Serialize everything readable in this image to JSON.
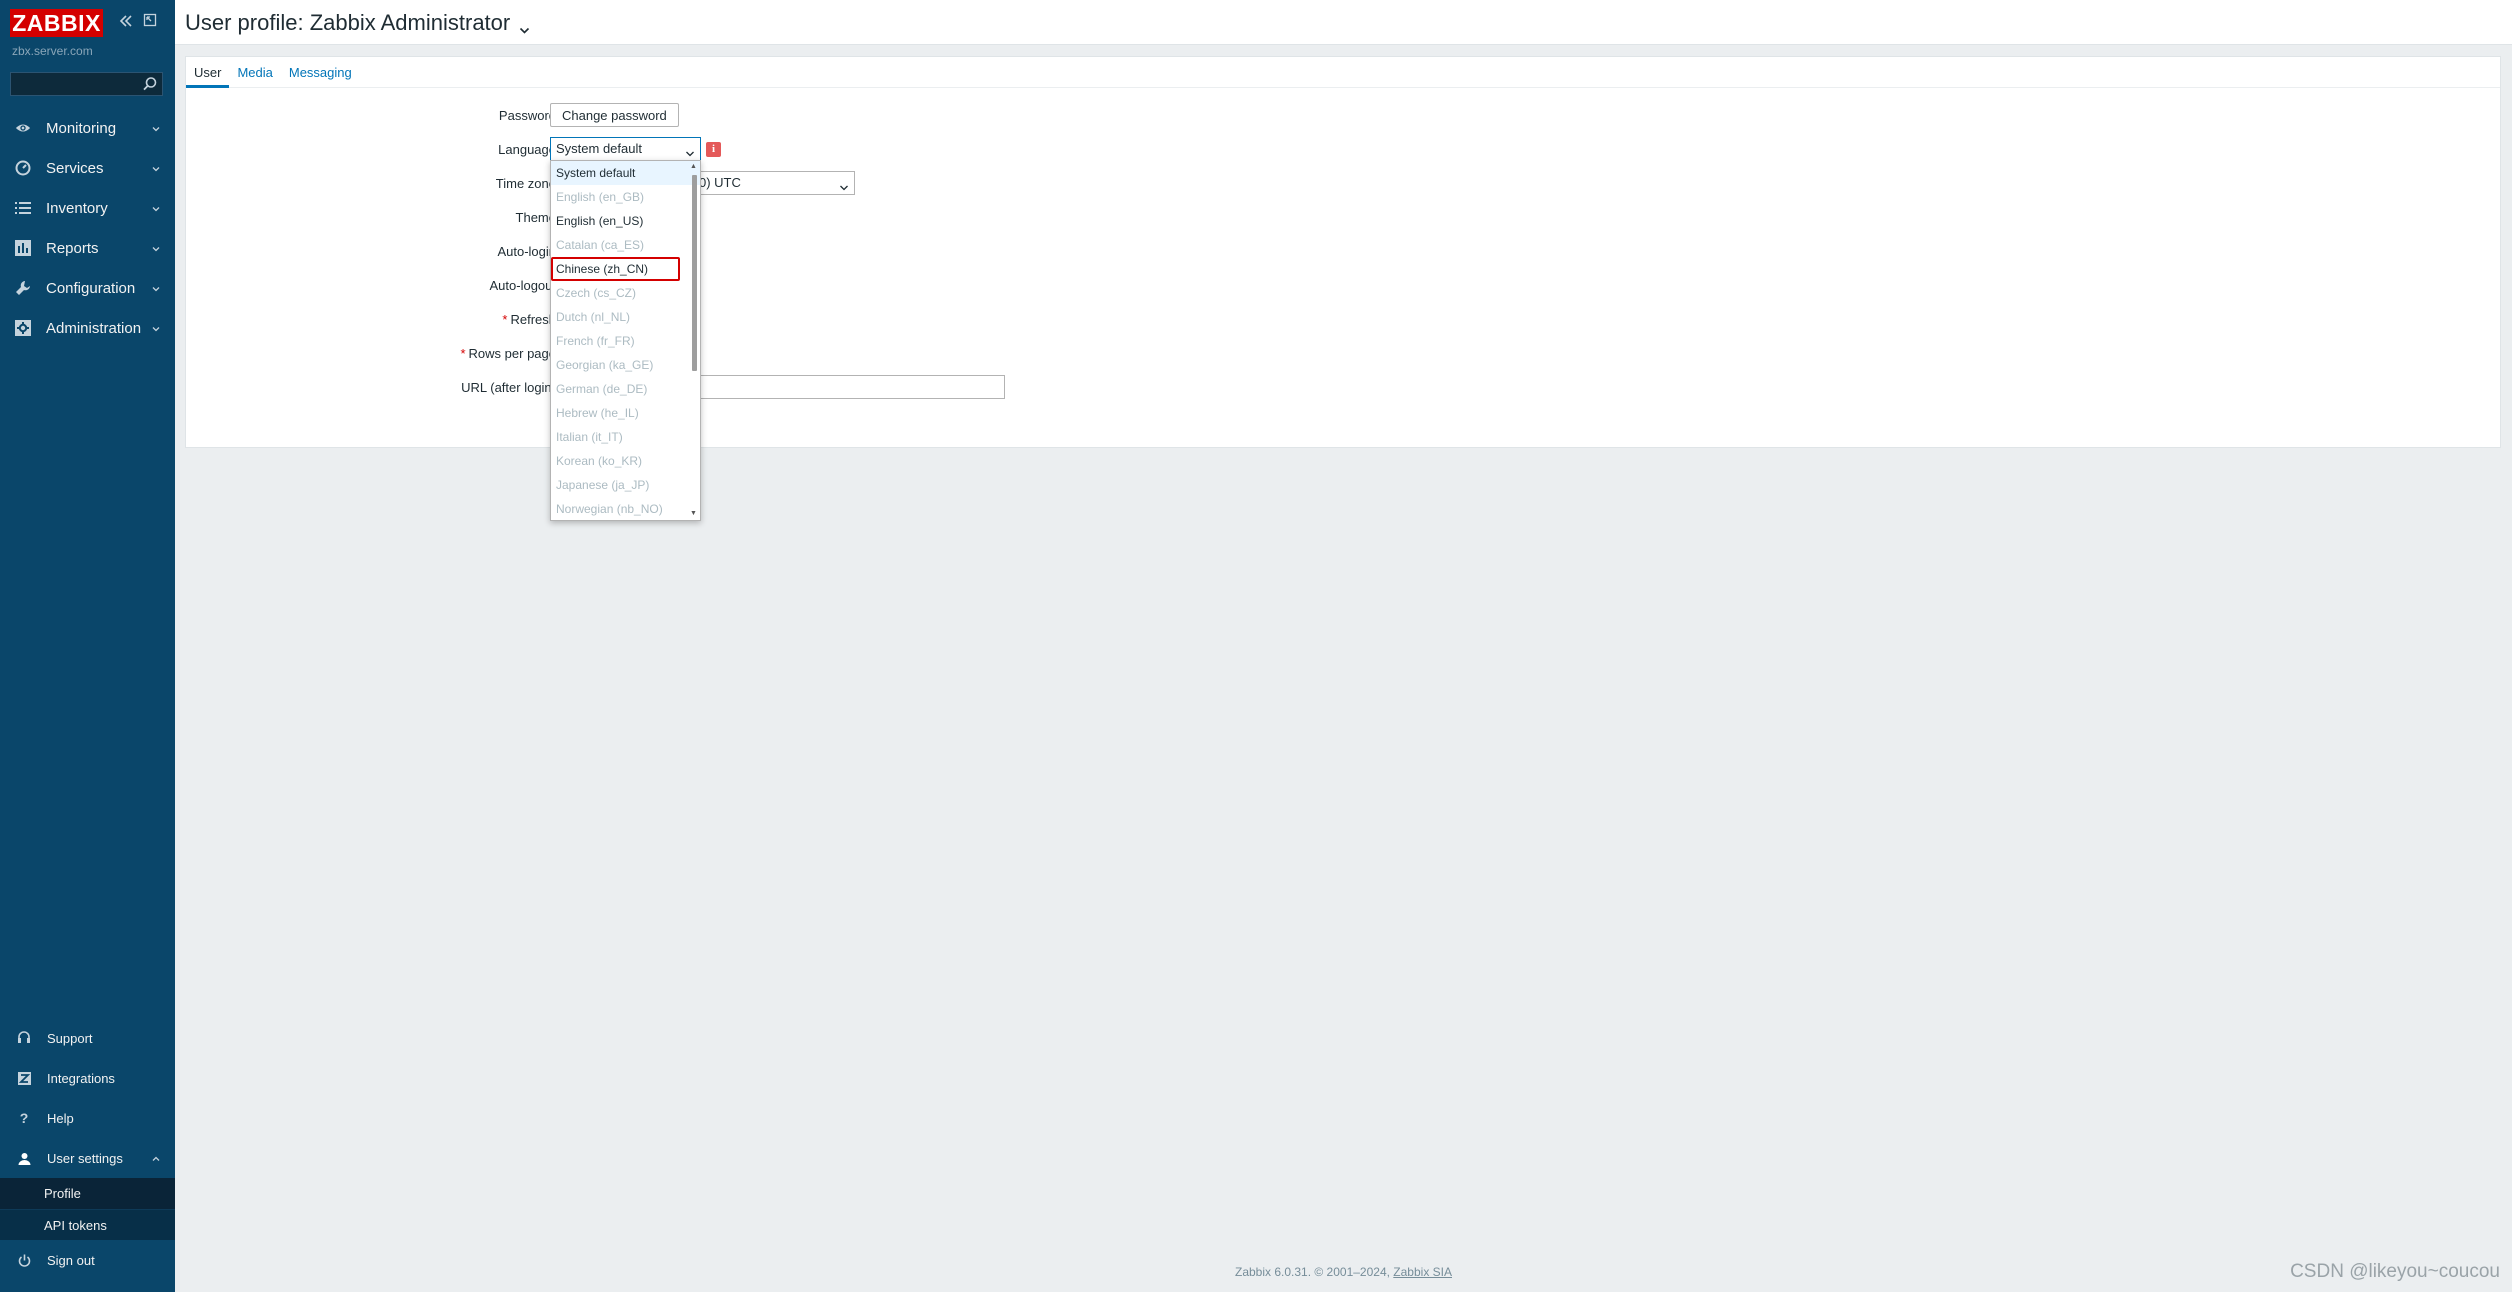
{
  "sidebar": {
    "logo": "ZABBIX",
    "server_name": "zbx.server.com",
    "search_placeholder": "",
    "menu": [
      {
        "label": "Monitoring",
        "icon": "eye-icon"
      },
      {
        "label": "Services",
        "icon": "services-icon"
      },
      {
        "label": "Inventory",
        "icon": "list-icon"
      },
      {
        "label": "Reports",
        "icon": "reports-icon"
      },
      {
        "label": "Configuration",
        "icon": "wrench-icon"
      },
      {
        "label": "Administration",
        "icon": "admin-icon"
      }
    ],
    "bottom": {
      "support": "Support",
      "integrations": "Integrations",
      "help": "Help",
      "user_settings": "User settings",
      "profile": "Profile",
      "api_tokens": "API tokens",
      "sign_out": "Sign out"
    }
  },
  "header": {
    "title": "User profile: Zabbix Administrator"
  },
  "tabs": [
    {
      "label": "User",
      "active": true
    },
    {
      "label": "Media",
      "active": false
    },
    {
      "label": "Messaging",
      "active": false
    }
  ],
  "form": {
    "labels": {
      "password": "Password",
      "language": "Language",
      "timezone": "Time zone",
      "theme": "Theme",
      "autologin": "Auto-login",
      "autologout": "Auto-logout",
      "refresh": "Refresh",
      "rows_per_page": "Rows per page",
      "url": "URL (after login)"
    },
    "required_mark": "*",
    "change_password_button": "Change password",
    "language_value": "System default",
    "info_icon": "i",
    "timezone_value_visible": "0) UTC",
    "url_value": ""
  },
  "language_dropdown": {
    "options": [
      {
        "label": "System default",
        "disabled": false,
        "hover": true,
        "highlighted": false
      },
      {
        "label": "English (en_GB)",
        "disabled": true,
        "hover": false,
        "highlighted": false
      },
      {
        "label": "English (en_US)",
        "disabled": false,
        "hover": false,
        "highlighted": false
      },
      {
        "label": "Catalan (ca_ES)",
        "disabled": true,
        "hover": false,
        "highlighted": false
      },
      {
        "label": "Chinese (zh_CN)",
        "disabled": false,
        "hover": false,
        "highlighted": true
      },
      {
        "label": "Czech (cs_CZ)",
        "disabled": true,
        "hover": false,
        "highlighted": false
      },
      {
        "label": "Dutch (nl_NL)",
        "disabled": true,
        "hover": false,
        "highlighted": false
      },
      {
        "label": "French (fr_FR)",
        "disabled": true,
        "hover": false,
        "highlighted": false
      },
      {
        "label": "Georgian (ka_GE)",
        "disabled": true,
        "hover": false,
        "highlighted": false
      },
      {
        "label": "German (de_DE)",
        "disabled": true,
        "hover": false,
        "highlighted": false
      },
      {
        "label": "Hebrew (he_IL)",
        "disabled": true,
        "hover": false,
        "highlighted": false
      },
      {
        "label": "Italian (it_IT)",
        "disabled": true,
        "hover": false,
        "highlighted": false
      },
      {
        "label": "Korean (ko_KR)",
        "disabled": true,
        "hover": false,
        "highlighted": false
      },
      {
        "label": "Japanese (ja_JP)",
        "disabled": true,
        "hover": false,
        "highlighted": false
      },
      {
        "label": "Norwegian (nb_NO)",
        "disabled": true,
        "hover": false,
        "highlighted": false
      }
    ]
  },
  "footer": {
    "text": "Zabbix 6.0.31. © 2001–2024, ",
    "link": "Zabbix SIA"
  },
  "watermark": "CSDN @likeyou~coucou",
  "colors": {
    "sidebar_bg": "#0a466a",
    "logo_red": "#d40000",
    "link_blue": "#0275b8",
    "highlight_red": "#d40000",
    "page_bg": "#ebeef0"
  }
}
